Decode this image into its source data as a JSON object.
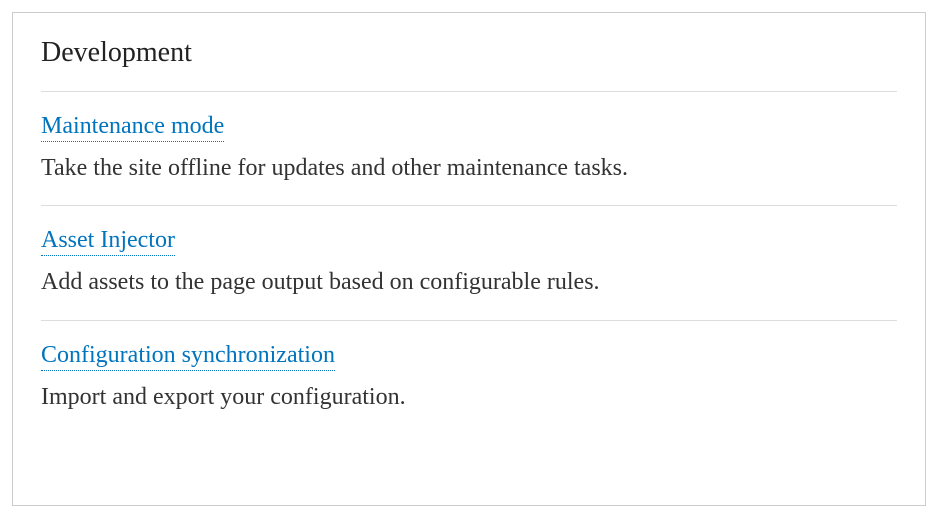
{
  "panel": {
    "title": "Development",
    "items": [
      {
        "link": "Maintenance mode",
        "desc": "Take the site offline for updates and other maintenance tasks."
      },
      {
        "link": "Asset Injector",
        "desc": "Add assets to the page output based on configurable rules."
      },
      {
        "link": "Configuration synchronization",
        "desc": "Import and export your configuration."
      }
    ]
  }
}
